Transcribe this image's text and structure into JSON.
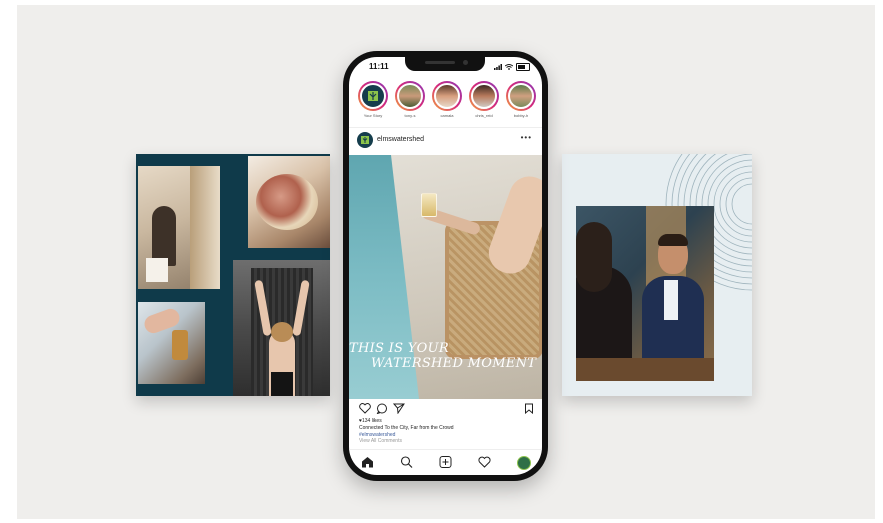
{
  "phone": {
    "status_time": "11:11",
    "stories": [
      {
        "name": "Your Story"
      },
      {
        "name": "tony-s"
      },
      {
        "name": "camala"
      },
      {
        "name": "chris_reid"
      },
      {
        "name": "bobby-h"
      }
    ],
    "post": {
      "username": "elmswatershed",
      "more_label": "•••",
      "headline_line1": "THIS IS YOUR",
      "headline_line2": "WATERSHED MOMENT",
      "likes": "♥134 likes",
      "caption": "Connected To the City, Far from the Crowd",
      "hashtag": "#elmswatershed",
      "comments_link": "View All Comments"
    },
    "icons": {
      "like": "heart-icon",
      "comment": "comment-icon",
      "share": "send-icon",
      "save": "bookmark-icon",
      "nav": [
        "home-icon",
        "search-icon",
        "add-post-icon",
        "activity-heart-icon",
        "profile-avatar"
      ]
    }
  },
  "colors": {
    "brand_teal": "#0f3a4a",
    "backdrop": "#efeeec",
    "hashtag_blue": "#3b5b9a"
  }
}
